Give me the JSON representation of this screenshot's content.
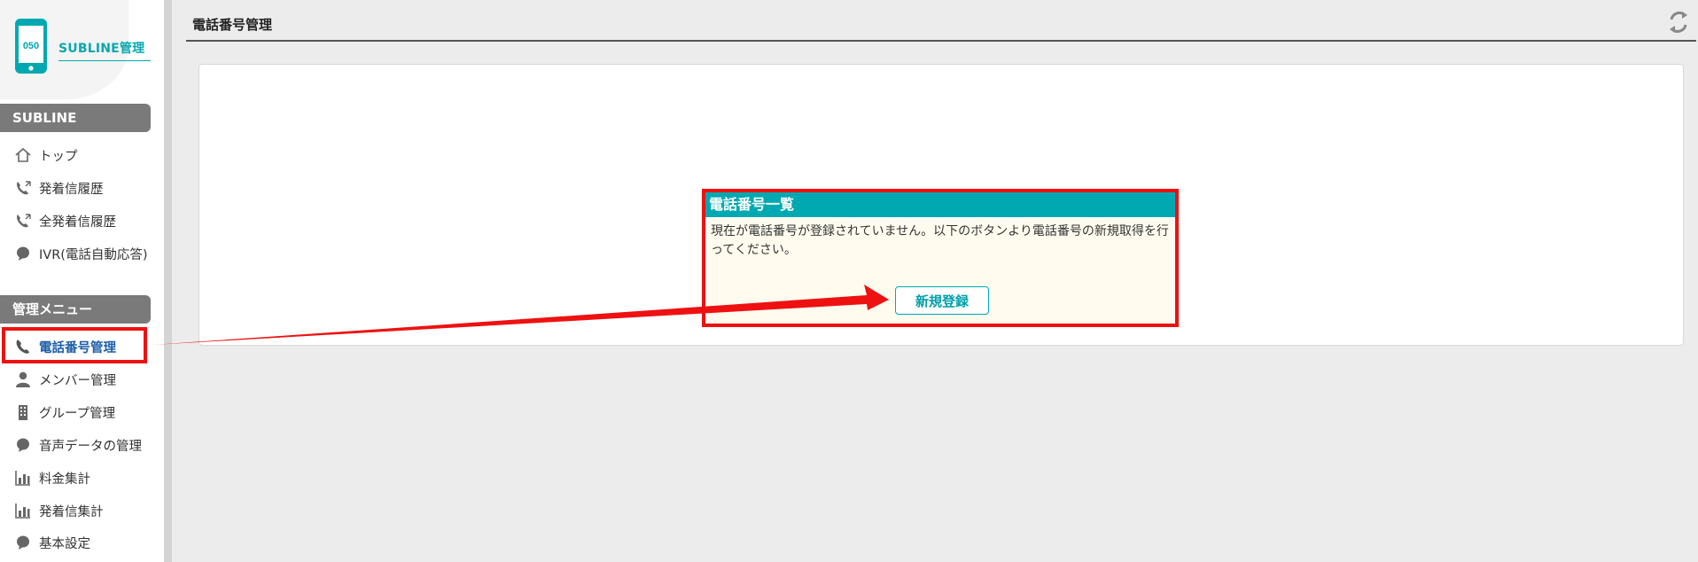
{
  "sidebar": {
    "brand_label": "SUBLINE管理",
    "phone_icon_text": "050",
    "sections": [
      {
        "label": "SUBLINE"
      },
      {
        "label": "管理メニュー"
      }
    ],
    "items": [
      {
        "label": "トップ",
        "icon": "home-icon"
      },
      {
        "label": "発着信履歴",
        "icon": "call-history-icon"
      },
      {
        "label": "全発着信履歴",
        "icon": "call-history-icon"
      },
      {
        "label": "IVR(電話自動応答)",
        "icon": "bubble-icon"
      },
      {
        "label": "電話番号管理",
        "icon": "phone-icon",
        "active": true
      },
      {
        "label": "メンバー管理",
        "icon": "person-icon"
      },
      {
        "label": "グループ管理",
        "icon": "building-icon"
      },
      {
        "label": "音声データの管理",
        "icon": "bubble-icon"
      },
      {
        "label": "料金集計",
        "icon": "bar-chart-icon"
      },
      {
        "label": "発着信集計",
        "icon": "bar-chart-icon"
      },
      {
        "label": "基本設定",
        "icon": "bubble-icon"
      }
    ]
  },
  "header": {
    "title": "電話番号管理",
    "refresh_icon": "refresh-icon"
  },
  "main": {
    "notice": {
      "title": "電話番号一覧",
      "text": "現在が電話番号が登録されていません。以下のボタンより電話番号の新規取得を行ってください。",
      "button_label": "新規登録"
    }
  },
  "colors": {
    "accent": "#00a9b1",
    "highlight": "#ee1111",
    "section_header": "#7a7a7a",
    "active_link": "#1d5ea8"
  }
}
